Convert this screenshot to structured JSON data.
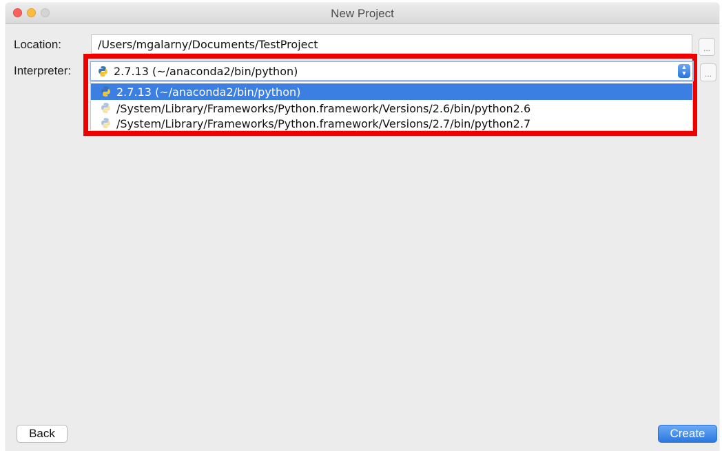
{
  "window": {
    "title": "New Project"
  },
  "form": {
    "location_label": "Location:",
    "location_value": "/Users/mgalarny/Documents/TestProject",
    "interpreter_label": "Interpreter:",
    "interpreter_selected": "2.7.13 (~/anaconda2/bin/python)",
    "browse_label": "..."
  },
  "dropdown": {
    "options": [
      {
        "label": "2.7.13 (~/anaconda2/bin/python)",
        "selected": true,
        "icon": "python-icon"
      },
      {
        "label": "/System/Library/Frameworks/Python.framework/Versions/2.6/bin/python2.6",
        "selected": false,
        "icon": "python-icon-faded"
      },
      {
        "label": "/System/Library/Frameworks/Python.framework/Versions/2.7/bin/python2.7",
        "selected": false,
        "icon": "python-icon-faded"
      }
    ]
  },
  "buttons": {
    "back": "Back",
    "create": "Create"
  },
  "colors": {
    "selection": "#3b7fe3",
    "highlight_box": "#ee0000",
    "create_button": "#2c78e0"
  }
}
